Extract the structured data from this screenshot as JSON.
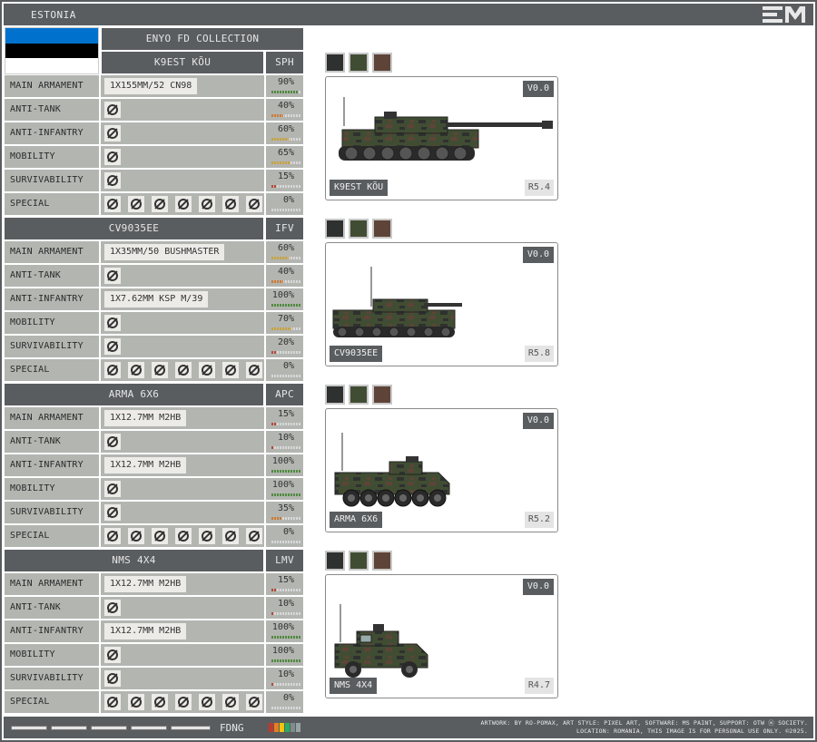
{
  "country": "ESTONIA",
  "collection_title": "ENYO FD COLLECTION",
  "flag_colors": [
    "#0072ce",
    "#000000",
    "#ffffff"
  ],
  "camo_palette": [
    "#2f3130",
    "#414d33",
    "#5e4438"
  ],
  "vehicles": [
    {
      "name": "K9EST KÕU",
      "role": "SPH",
      "version": "V0.0",
      "rating": "R5.4",
      "stats": {
        "main_armament": {
          "label": "MAIN ARMAMENT",
          "weapon": "1X155MM/52 CN98",
          "percent": "90%",
          "fill": 0.9
        },
        "anti_tank": {
          "label": "ANTI-TANK",
          "weapon": null,
          "percent": "40%",
          "fill": 0.4
        },
        "anti_infantry": {
          "label": "ANTI-INFANTRY",
          "weapon": null,
          "percent": "60%",
          "fill": 0.6
        },
        "mobility": {
          "label": "MOBILITY",
          "weapon": null,
          "percent": "65%",
          "fill": 0.65
        },
        "survivability": {
          "label": "SURVIVABILITY",
          "weapon": null,
          "percent": "15%",
          "fill": 0.15
        },
        "special": {
          "label": "SPECIAL",
          "percent": "0%",
          "fill": 0
        }
      }
    },
    {
      "name": "CV9035EE",
      "role": "IFV",
      "version": "V0.0",
      "rating": "R5.8",
      "stats": {
        "main_armament": {
          "label": "MAIN ARMAMENT",
          "weapon": "1X35MM/50 BUSHMASTER",
          "percent": "60%",
          "fill": 0.6
        },
        "anti_tank": {
          "label": "ANTI-TANK",
          "weapon": null,
          "percent": "40%",
          "fill": 0.4
        },
        "anti_infantry": {
          "label": "ANTI-INFANTRY",
          "weapon": "1X7.62MM KSP M/39",
          "percent": "100%",
          "fill": 1
        },
        "mobility": {
          "label": "MOBILITY",
          "weapon": null,
          "percent": "70%",
          "fill": 0.7
        },
        "survivability": {
          "label": "SURVIVABILITY",
          "weapon": null,
          "percent": "20%",
          "fill": 0.2
        },
        "special": {
          "label": "SPECIAL",
          "percent": "0%",
          "fill": 0
        }
      }
    },
    {
      "name": "ARMA 6X6",
      "role": "APC",
      "version": "V0.0",
      "rating": "R5.2",
      "stats": {
        "main_armament": {
          "label": "MAIN ARMAMENT",
          "weapon": "1X12.7MM M2HB",
          "percent": "15%",
          "fill": 0.15
        },
        "anti_tank": {
          "label": "ANTI-TANK",
          "weapon": null,
          "percent": "10%",
          "fill": 0.1
        },
        "anti_infantry": {
          "label": "ANTI-INFANTRY",
          "weapon": "1X12.7MM M2HB",
          "percent": "100%",
          "fill": 1
        },
        "mobility": {
          "label": "MOBILITY",
          "weapon": null,
          "percent": "100%",
          "fill": 1
        },
        "survivability": {
          "label": "SURVIVABILITY",
          "weapon": null,
          "percent": "35%",
          "fill": 0.35
        },
        "special": {
          "label": "SPECIAL",
          "percent": "0%",
          "fill": 0
        }
      }
    },
    {
      "name": "NMS 4X4",
      "role": "LMV",
      "version": "V0.0",
      "rating": "R4.7",
      "stats": {
        "main_armament": {
          "label": "MAIN ARMAMENT",
          "weapon": "1X12.7MM M2HB",
          "percent": "15%",
          "fill": 0.15
        },
        "anti_tank": {
          "label": "ANTI-TANK",
          "weapon": null,
          "percent": "10%",
          "fill": 0.1
        },
        "anti_infantry": {
          "label": "ANTI-INFANTRY",
          "weapon": "1X12.7MM M2HB",
          "percent": "100%",
          "fill": 1
        },
        "mobility": {
          "label": "MOBILITY",
          "weapon": null,
          "percent": "100%",
          "fill": 1
        },
        "survivability": {
          "label": "SURVIVABILITY",
          "weapon": null,
          "percent": "10%",
          "fill": 0.1
        },
        "special": {
          "label": "SPECIAL",
          "percent": "0%",
          "fill": 0
        }
      }
    }
  ],
  "footer": {
    "code": "FDNG",
    "credits_line1": "ARTWORK: BY RO-POMAX, ART STYLE: PIXEL ART, SOFTWARE: MS PAINT, SUPPORT: OTW ⓦ SOCIETY.",
    "credits_line2": "LOCATION: ROMANIA, THIS IMAGE IS FOR PERSONAL USE ONLY. ©2025."
  }
}
